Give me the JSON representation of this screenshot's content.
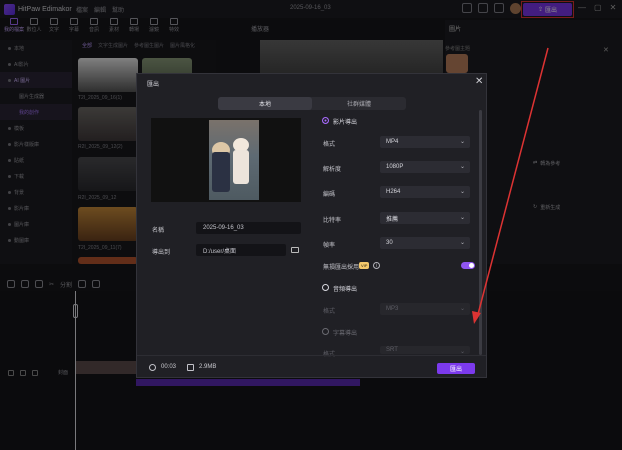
{
  "app": {
    "name": "HitPaw Edimakor",
    "menu": [
      "檔案",
      "編輯",
      "幫助"
    ],
    "doc_title": "2025-09-16_03",
    "export_label": "匯出"
  },
  "toolbar": [
    {
      "label": "我的檔案",
      "active": true
    },
    {
      "label": "數位人",
      "active": false
    },
    {
      "label": "文字",
      "active": false
    },
    {
      "label": "字幕",
      "active": false
    },
    {
      "label": "音訊",
      "active": false
    },
    {
      "label": "素材",
      "active": false
    },
    {
      "label": "轉場",
      "active": false
    },
    {
      "label": "濾鏡",
      "active": false
    },
    {
      "label": "特效",
      "active": false
    }
  ],
  "sidebar": [
    {
      "label": "本地",
      "active": false,
      "sub": false
    },
    {
      "label": "AI影片",
      "active": false,
      "sub": false
    },
    {
      "label": "AI 圖片",
      "active": true,
      "sub": false
    },
    {
      "label": "圖片生成器",
      "active": false,
      "sub": true
    },
    {
      "label": "我的創作",
      "active": true,
      "sub": true
    },
    {
      "label": "模板",
      "active": false,
      "sub": false
    },
    {
      "label": "影片樣版庫",
      "active": false,
      "sub": false
    },
    {
      "label": "貼紙",
      "active": false,
      "sub": false
    },
    {
      "label": "下載",
      "active": false,
      "sub": false
    },
    {
      "label": "背景",
      "active": false,
      "sub": false
    },
    {
      "label": "影片庫",
      "active": false,
      "sub": false
    },
    {
      "label": "圖片庫",
      "active": false,
      "sub": false
    },
    {
      "label": "動圖庫",
      "active": false,
      "sub": false
    }
  ],
  "content": {
    "tabs": [
      "全部",
      "文字生成圖片",
      "參考圖生圖片",
      "圖片風格化"
    ],
    "thumbs": [
      {
        "caption": "T2I_2025_09_16(1)"
      },
      {
        "caption": "R2I_2025_09_12(2)"
      },
      {
        "caption": "R2I_2025_09_12"
      },
      {
        "caption": "T2I_2025_09_11(7)"
      }
    ]
  },
  "preview": {
    "title": "播放器"
  },
  "right_panel": {
    "tab": "圖片",
    "ref_label": "參考圖主題",
    "convert_label": "轉為參考",
    "regen_label": "重新生成"
  },
  "timeline": {
    "split_label": "分割",
    "track_label": "封面",
    "clip_label": "R2I_2025_09_12(2)"
  },
  "modal": {
    "title": "匯出",
    "tabs": [
      {
        "label": "本地",
        "active": true
      },
      {
        "label": "社群媒體",
        "active": false
      }
    ],
    "name_label": "名稱",
    "name_value": "2025-09-16_03",
    "path_label": "導出到",
    "path_value": "D:/user/桌面",
    "video_section": "影片導出",
    "format_label": "格式",
    "format_value": "MP4",
    "resolution_label": "解析度",
    "resolution_value": "1080P",
    "codec_label": "編碼",
    "codec_value": "H264",
    "bitrate_label": "比特率",
    "bitrate_value": "推薦",
    "fps_label": "幀率",
    "fps_value": "30",
    "watermark_label": "無損匯出採用",
    "vip_badge": "VIP",
    "audio_section": "音頻導出",
    "audio_format_label": "格式",
    "audio_format_value": "MP3",
    "subtitle_section": "字幕導出",
    "subtitle_format_label": "格式",
    "subtitle_format_value": "SRT",
    "duration": "00:03",
    "filesize": "2.9MB",
    "export_button": "匯出"
  },
  "colors": {
    "accent": "#7c3aed",
    "highlight_box": "#dd3333",
    "arrow": "#dd3333"
  }
}
